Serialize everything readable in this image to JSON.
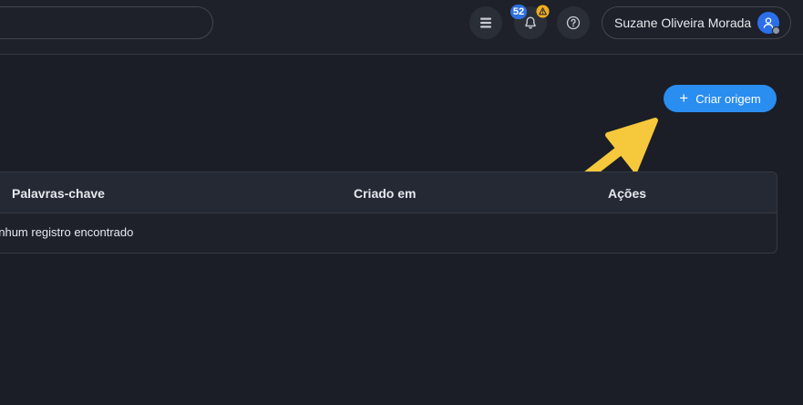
{
  "header": {
    "notifications_count": "52",
    "user_name": "Suzane Oliveira Morada",
    "icons": [
      "menu-stack-icon",
      "bell-icon",
      "warning-icon",
      "help-icon",
      "user-icon"
    ]
  },
  "actions": {
    "create_label": "Criar origem",
    "create_icon": "plus-icon"
  },
  "table": {
    "columns": [
      "Palavras-chave",
      "Criado em",
      "Ações"
    ],
    "empty_message": "enhum registro encontrado"
  },
  "colors": {
    "background": "#1b1e26",
    "primary": "#2a8df0",
    "badge": "#2f6fe0",
    "warning": "#f0ad1c",
    "arrow": "#f6c83b"
  }
}
